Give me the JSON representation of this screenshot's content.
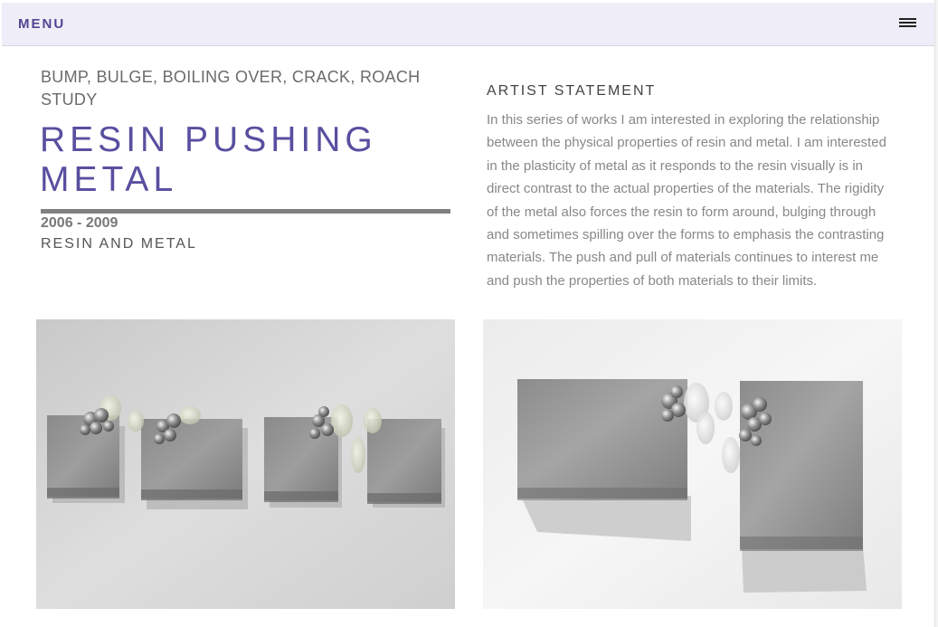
{
  "nav": {
    "menu_label": "MENU",
    "hamburger_icon": "hamburger-menu-icon"
  },
  "project": {
    "subtitle": "BUMP, BULGE, BOILING OVER, CRACK, ROACH STUDY",
    "title": "RESIN PUSHING METAL",
    "years": "2006 - 2009",
    "medium": "RESIN AND METAL"
  },
  "statement": {
    "heading": "ARTIST STATEMENT",
    "body": "In this series of works I am interested in exploring the relationship between the physical properties of resin and metal. I am interested in the plasticity of metal as it responds to the resin visually is in direct contrast to the actual properties of the materials. The rigidity of the metal also forces the resin to form around, bulging through and sometimes spilling over the forms to emphasis the contrasting materials. The push and pull of materials continues to interest me and push the properties of both materials to their limits."
  },
  "images": [
    {
      "name": "artwork-photo-four-panels"
    },
    {
      "name": "artwork-photo-two-panels"
    }
  ],
  "colors": {
    "accent": "#584fa0",
    "nav_background": "#efedf7",
    "rule": "#808080"
  }
}
